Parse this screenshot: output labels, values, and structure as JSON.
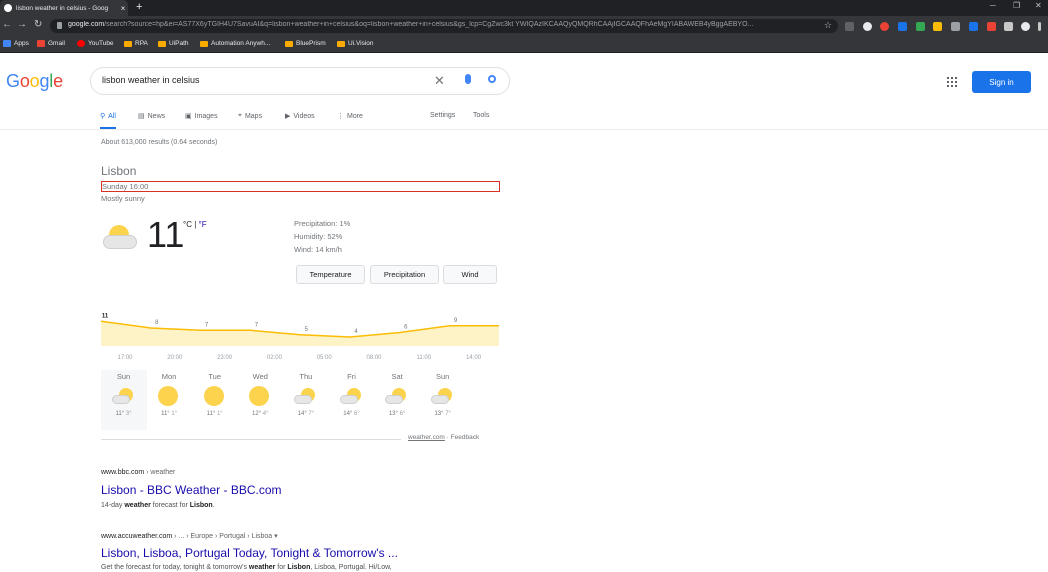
{
  "browser": {
    "tab_title": "lisbon weather in celsius - Goog",
    "tab_close": "×",
    "new_tab": "+",
    "url_host": "google.com",
    "url_path": "/search?source=hp&ei=AS77X6yTGIH4U7SavuAI&q=lisbon+weather+in+celsius&oq=lisbon+weather+in+celsius&gs_lcp=CgZwc3kt YWIQAzIKCAAQyQMQRhCAAjIGCAAQFhAeMgYIABAWEB4yBggAEBYO...",
    "bookmarks": [
      "Apps",
      "Gmail",
      "YouTube",
      "RPA",
      "UiPath",
      "Automation Anywh...",
      "BluePrism",
      "Ui.Vision"
    ]
  },
  "google": {
    "logo": "Google",
    "query": "lisbon weather in celsius",
    "sign_in": "Sign in",
    "tabs": [
      "All",
      "News",
      "Images",
      "Maps",
      "Videos",
      "More"
    ],
    "settings": "Settings",
    "tools": "Tools",
    "stats": "About 613,000 results (0.64 seconds)"
  },
  "weather": {
    "city": "Lisbon",
    "time": "Sunday 16:00",
    "condition": "Mostly sunny",
    "temp": "11",
    "unit_c": "°C",
    "unit_sep": " | ",
    "unit_f": "°F",
    "precipitation": "Precipitation: 1%",
    "humidity": "Humidity: 52%",
    "wind": "Wind: 14 km/h",
    "buttons": [
      "Temperature",
      "Precipitation",
      "Wind"
    ],
    "source": "weather.com",
    "source_sep": "·",
    "feedback": "Feedback"
  },
  "chart_data": {
    "type": "area",
    "x": [
      "17:00",
      "20:00",
      "23:00",
      "02:00",
      "05:00",
      "08:00",
      "11:00",
      "14:00"
    ],
    "labels": [
      "11",
      "8",
      "7",
      "7",
      "5",
      "4",
      "6",
      "9"
    ],
    "values": [
      11,
      8,
      7,
      7,
      5,
      4,
      6,
      9
    ]
  },
  "forecast": [
    {
      "day": "Sun",
      "icon": "partly-sunny",
      "hi": "11°",
      "lo": "3°"
    },
    {
      "day": "Mon",
      "icon": "sunny",
      "hi": "11°",
      "lo": "1°"
    },
    {
      "day": "Tue",
      "icon": "sunny",
      "hi": "11°",
      "lo": "1°"
    },
    {
      "day": "Wed",
      "icon": "sunny",
      "hi": "12°",
      "lo": "4°"
    },
    {
      "day": "Thu",
      "icon": "partly-cloudy",
      "hi": "14°",
      "lo": "7°"
    },
    {
      "day": "Fri",
      "icon": "partly-cloudy",
      "hi": "14°",
      "lo": "6°"
    },
    {
      "day": "Sat",
      "icon": "partly-cloudy",
      "hi": "13°",
      "lo": "6°"
    },
    {
      "day": "Sun",
      "icon": "partly-cloudy",
      "hi": "13°",
      "lo": "7°"
    }
  ],
  "results": [
    {
      "cite_host": "www.bbc.com",
      "cite_path": " › weather",
      "title": "Lisbon - BBC Weather - BBC.com",
      "snippet_pre": "14-day ",
      "snippet_b1": "weather",
      "snippet_mid": " forecast for ",
      "snippet_b2": "Lisbon",
      "snippet_post": "."
    },
    {
      "cite_host": "www.accuweather.com",
      "cite_path": " › ... › Europe › Portugal › Lisboa ▾",
      "title": "Lisbon, Lisboa, Portugal Today, Tonight & Tomorrow's ...",
      "snippet_pre": "Get the forecast for today, tonight & tomorrow's ",
      "snippet_b1": "weather",
      "snippet_mid": " for ",
      "snippet_b2": "Lisbon",
      "snippet_post": ", Lisboa, Portugal. Hi/Low,"
    }
  ]
}
